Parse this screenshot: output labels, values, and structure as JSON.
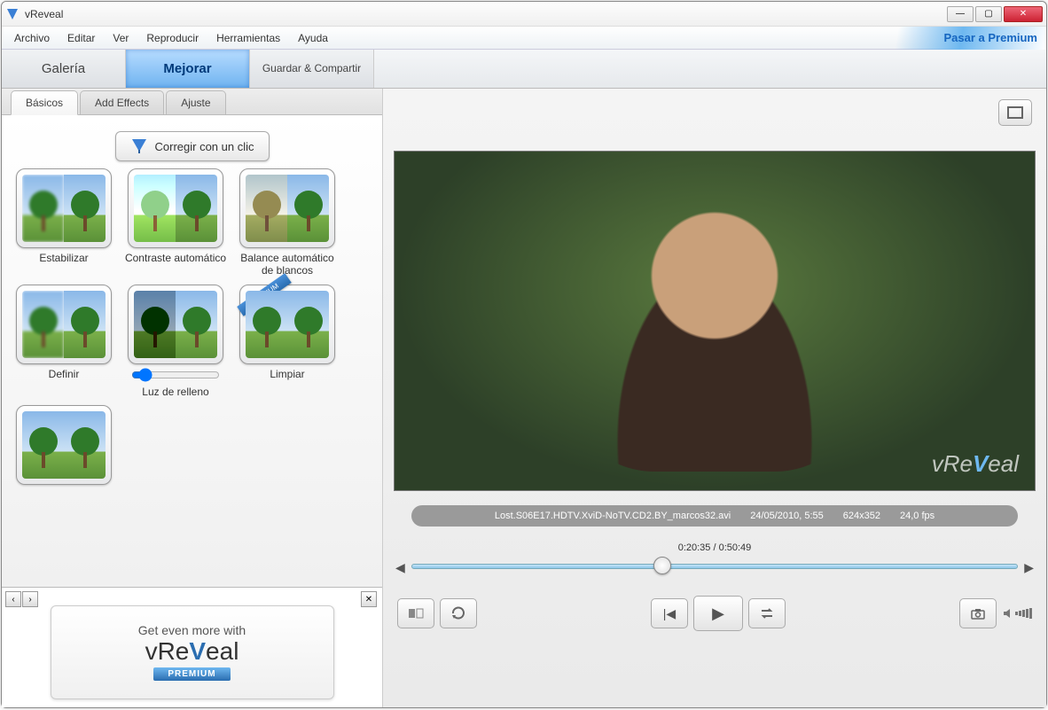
{
  "window": {
    "title": "vReveal"
  },
  "menubar": {
    "items": [
      "Archivo",
      "Editar",
      "Ver",
      "Reproducir",
      "Herramientas",
      "Ayuda"
    ],
    "premium_link": "Pasar a Premium"
  },
  "modes": {
    "gallery": "Galería",
    "enhance": "Mejorar",
    "save_share": "Guardar & Compartir"
  },
  "tabs": {
    "basic": "Básicos",
    "add_effects": "Add Effects",
    "adjust": "Ajuste"
  },
  "one_click_label": "Corregir con un clic",
  "effects": [
    {
      "id": "stabilize",
      "label": "Estabilizar"
    },
    {
      "id": "auto_contrast",
      "label": "Contraste automático"
    },
    {
      "id": "auto_wb",
      "label": "Balance automático de blancos"
    },
    {
      "id": "define",
      "label": "Definir"
    },
    {
      "id": "fill_light",
      "label": "Luz de relleno",
      "has_slider": true
    },
    {
      "id": "clean",
      "label": "Limpiar",
      "premium": true
    }
  ],
  "premium_ribbon": "PREMIUM",
  "promo": {
    "headline": "Get even more with",
    "brand_left": "vRe",
    "brand_right": "eal",
    "badge": "PREMIUM"
  },
  "video_info": {
    "filename": "Lost.S06E17.HDTV.XviD-NoTV.CD2.BY_marcos32.avi",
    "date": "24/05/2010, 5:55",
    "resolution": "624x352",
    "fps": "24,0 fps"
  },
  "playback": {
    "position": "0:20:35",
    "duration": "0:50:49",
    "progress_pct": 40.5
  },
  "watermark": {
    "left": "vRe",
    "right": "eal"
  }
}
